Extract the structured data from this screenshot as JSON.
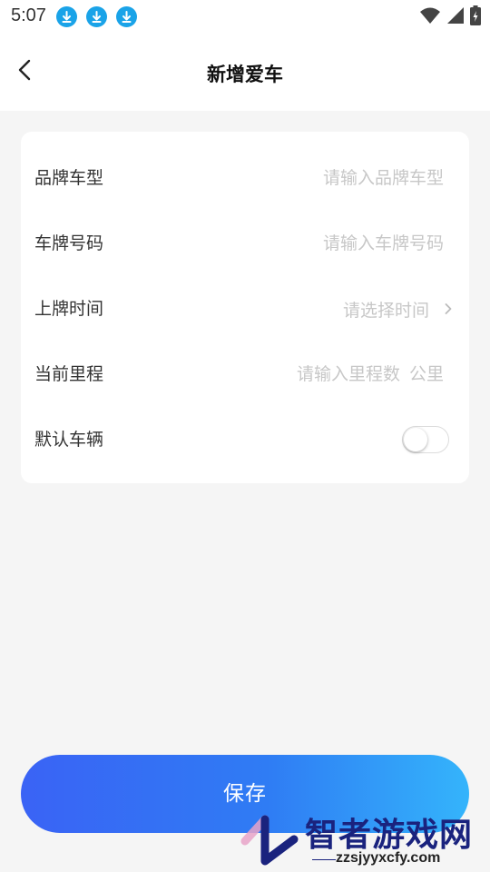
{
  "status_bar": {
    "time": "5:07",
    "download_icon_count": 3,
    "icons": [
      "download-icon",
      "download-icon",
      "download-icon",
      "wifi-icon",
      "signal-icon",
      "battery-icon"
    ]
  },
  "nav": {
    "back_icon": "chevron-left-icon",
    "title": "新增爱车"
  },
  "form": {
    "rows": [
      {
        "label": "品牌车型",
        "placeholder": "请输入品牌车型",
        "value": ""
      },
      {
        "label": "车牌号码",
        "placeholder": "请输入车牌号码",
        "value": ""
      },
      {
        "label": "上牌时间",
        "placeholder": "请选择时间",
        "icon": "chevron-right-icon"
      },
      {
        "label": "当前里程",
        "placeholder": "请输入里程数",
        "unit": "公里",
        "value": ""
      },
      {
        "label": "默认车辆",
        "toggle_on": false
      }
    ]
  },
  "save_button": {
    "label": "保存"
  },
  "watermark": {
    "title": "智者游戏网",
    "url": "zzsjyyxcfy.com"
  },
  "colors": {
    "accent_start": "#3a63f5",
    "accent_end": "#34b4fb",
    "placeholder": "#c7c7c7",
    "download_icon": "#1aa3e8"
  }
}
